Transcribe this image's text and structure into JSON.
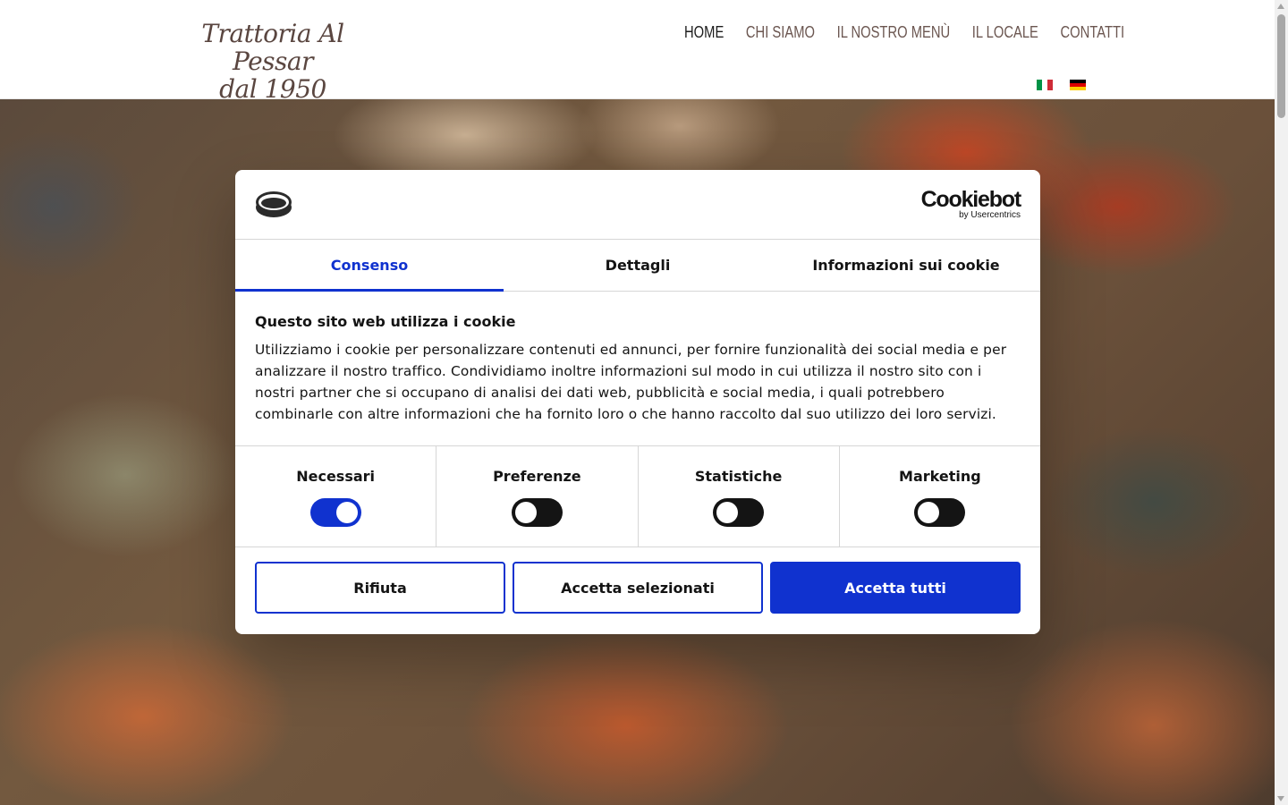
{
  "site": {
    "logo_line1": "Trattoria Al Pessar",
    "logo_line2": "dal 1950",
    "nav": [
      "HOME",
      "CHI SIAMO",
      "IL NOSTRO MENÙ",
      "IL LOCALE",
      "CONTATTI"
    ],
    "active_nav": "HOME",
    "languages": [
      {
        "code": "it",
        "icon": "italian-flag-icon",
        "colors": [
          "#009246",
          "#ffffff",
          "#ce2b37"
        ]
      },
      {
        "code": "de",
        "icon": "german-flag-icon",
        "colors": [
          "#000000",
          "#dd0000",
          "#ffce00"
        ]
      }
    ]
  },
  "cookie_dialog": {
    "brand": "Cookiebot",
    "brand_sub": "by Usercentrics",
    "tabs": [
      "Consenso",
      "Dettagli",
      "Informazioni sui cookie"
    ],
    "active_tab": "Consenso",
    "title": "Questo sito web utilizza i cookie",
    "text": "Utilizziamo i cookie per personalizzare contenuti ed annunci, per fornire funzionalità dei social media e per analizzare il nostro traffico. Condividiamo inoltre informazioni sul modo in cui utilizza il nostro sito con i nostri partner che si occupano di analisi dei dati web, pubblicità e social media, i quali potrebbero combinarle con altre informazioni che ha fornito loro o che hanno raccolto dal suo utilizzo dei loro servizi.",
    "consents": [
      {
        "label": "Necessari",
        "enabled": true
      },
      {
        "label": "Preferenze",
        "enabled": false
      },
      {
        "label": "Statistiche",
        "enabled": false
      },
      {
        "label": "Marketing",
        "enabled": false
      }
    ],
    "buttons": {
      "reject": "Rifiuta",
      "accept_selected": "Accetta selezionati",
      "accept_all": "Accetta tutti"
    },
    "accent_color": "#1032cf"
  }
}
